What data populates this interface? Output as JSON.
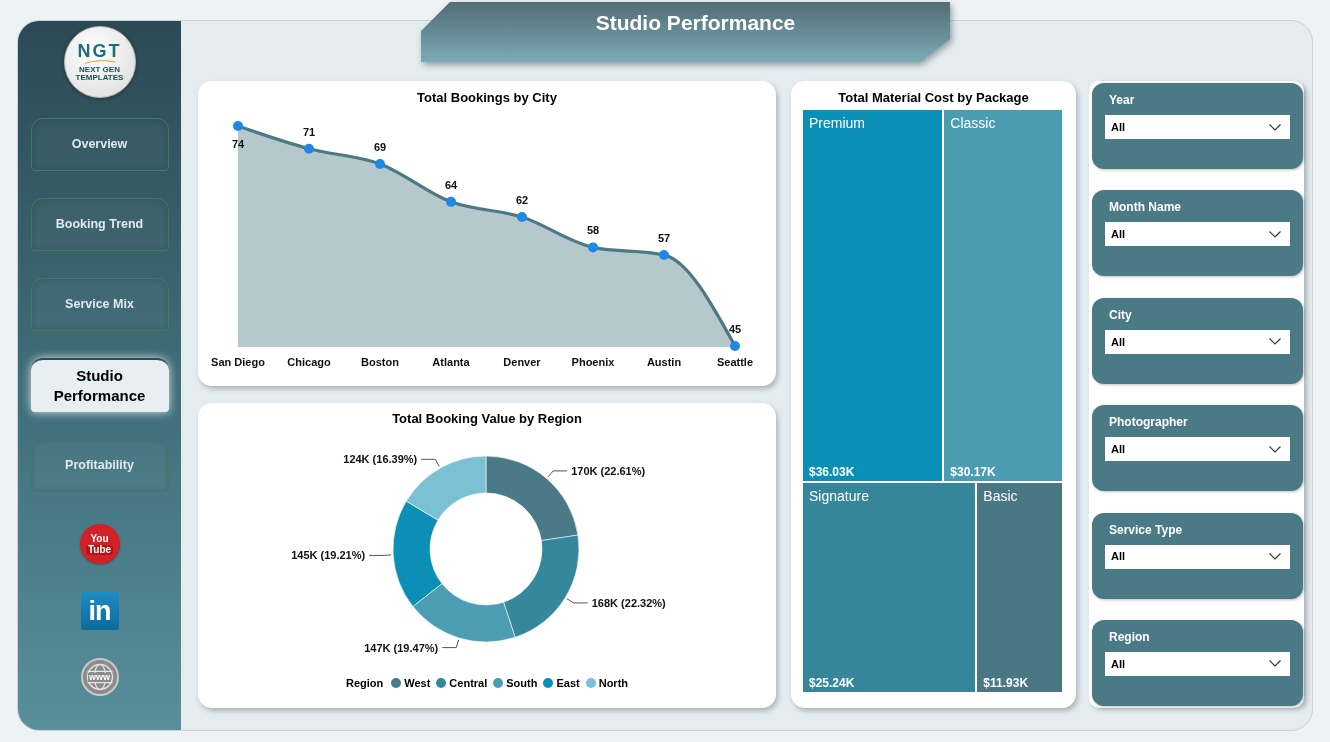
{
  "header": {
    "title": "Studio Performance"
  },
  "sidebar": {
    "logo": {
      "initials": "NGT",
      "tagline": "NEXT GEN TEMPLATES"
    },
    "nav": [
      {
        "label": "Overview",
        "selected": false
      },
      {
        "label": "Booking Trend",
        "selected": false
      },
      {
        "label": "Service Mix",
        "selected": false
      },
      {
        "label": "Studio Performance",
        "selected": true
      },
      {
        "label": "Profitability",
        "selected": false
      }
    ],
    "links": [
      {
        "kind": "youtube",
        "lines": [
          "You",
          "Tube"
        ]
      },
      {
        "kind": "linkedin",
        "lines": [
          "in"
        ]
      },
      {
        "kind": "website",
        "lines": [
          "www"
        ]
      }
    ]
  },
  "bookings_by_city": {
    "title": "Total Bookings by City",
    "chart_data": {
      "type": "area",
      "categories": [
        "San Diego",
        "Chicago",
        "Boston",
        "Atlanta",
        "Denver",
        "Phoenix",
        "Austin",
        "Seattle"
      ],
      "series": [
        {
          "color": "#4c7984",
          "values": [
            74,
            71,
            69,
            64,
            62,
            58,
            57,
            45
          ]
        }
      ],
      "data_labels": true
    }
  },
  "booking_value_by_region": {
    "title": "Total Booking Value by Region",
    "chart_data": {
      "type": "donut",
      "legend_title": "Region",
      "categories": [
        "West",
        "Central",
        "South",
        "East",
        "North"
      ],
      "colors": [
        "#4a7a87",
        "#35879c",
        "#4b9db3",
        "#0b8fb6",
        "#7cc0d4"
      ],
      "values": [
        22.61,
        22.32,
        19.47,
        19.21,
        16.39
      ],
      "value_labels": [
        "170K (22.61%)",
        "168K (22.32%)",
        "147K (19.47%)",
        "145K (19.21%)",
        "124K (16.39%)"
      ]
    }
  },
  "material_cost_by_package": {
    "title": "Total Material Cost by Package",
    "tiles": [
      {
        "package": "Premium",
        "cost": "$36.03K",
        "color": "#0a90b6"
      },
      {
        "package": "Classic",
        "cost": "$30.17K",
        "color": "#4a9cb1"
      },
      {
        "package": "Signature",
        "cost": "$25.24K",
        "color": "#35869b"
      },
      {
        "package": "Basic",
        "cost": "$11.93K",
        "color": "#4a7784"
      }
    ]
  },
  "slicers": [
    {
      "label": "Year",
      "value": "All"
    },
    {
      "label": "Month Name",
      "value": "All"
    },
    {
      "label": "City",
      "value": "All"
    },
    {
      "label": "Photographer",
      "value": "All"
    },
    {
      "label": "Service Type",
      "value": "All"
    },
    {
      "label": "Region",
      "value": "All"
    }
  ]
}
